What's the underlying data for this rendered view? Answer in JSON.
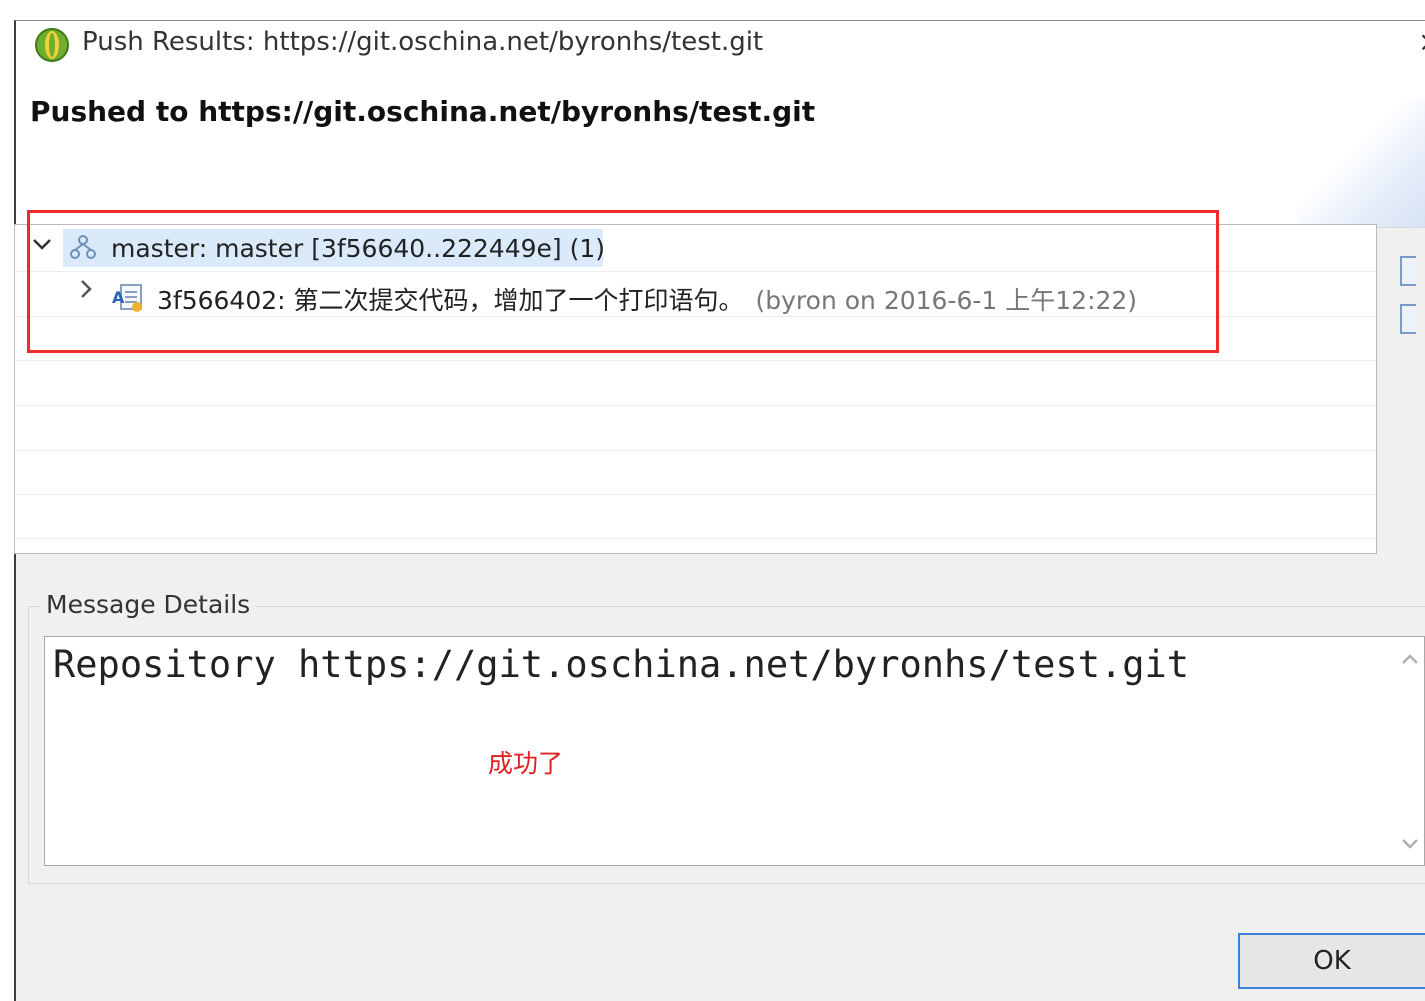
{
  "window": {
    "title": "Push Results: https://git.oschina.net/byronhs/test.git",
    "close_glyph": "×"
  },
  "header": {
    "heading": "Pushed to https://git.oschina.net/byronhs/test.git"
  },
  "tree": {
    "branch": {
      "expand_glyph": "⌄",
      "icon": "branch-icon",
      "label": "master: master [3f56640..222449e] (1)"
    },
    "commit": {
      "expand_glyph": "›",
      "icon": "commit-icon",
      "label": "3f566402: 第二次提交代码，增加了一个打印语句。",
      "meta": "(byron on 2016-6-1 上午12:22)"
    }
  },
  "details": {
    "group_label": "Message Details",
    "message": "Repository https://git.oschina.net/byronhs/test.git",
    "annotation": "成功了"
  },
  "buttons": {
    "ok": "OK"
  },
  "colors": {
    "highlight_border": "#ee2a2a",
    "selection_bg": "#dbeafb",
    "ok_border": "#3c7fd8",
    "annotation_text": "#e02020"
  }
}
